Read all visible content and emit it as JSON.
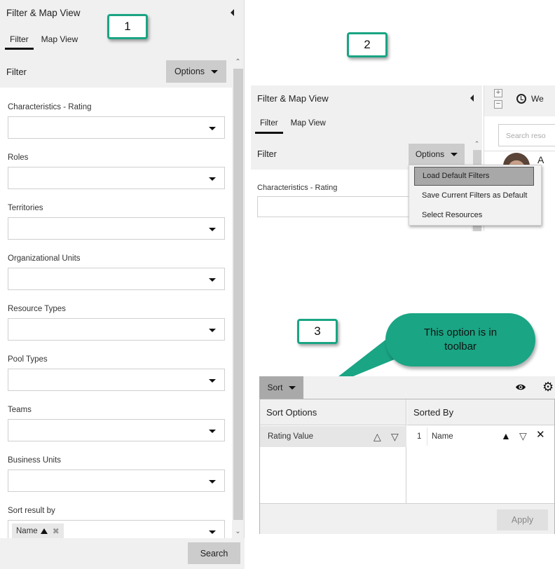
{
  "colors": {
    "accent_teal": "#1aa584",
    "panel_bg": "#f0f0f0",
    "button_bg": "#cccccc",
    "menu_highlight": "#a8a8a8"
  },
  "steps": [
    "1",
    "2",
    "3"
  ],
  "panel1": {
    "title": "Filter & Map View",
    "tabs": [
      {
        "label": "Filter",
        "active": true
      },
      {
        "label": "Map View",
        "active": false
      }
    ],
    "filter_label": "Filter",
    "options_label": "Options",
    "fields": [
      {
        "label": "Characteristics - Rating",
        "value": ""
      },
      {
        "label": "Roles",
        "value": ""
      },
      {
        "label": "Territories",
        "value": ""
      },
      {
        "label": "Organizational Units",
        "value": ""
      },
      {
        "label": "Resource Types",
        "value": ""
      },
      {
        "label": "Pool Types",
        "value": ""
      },
      {
        "label": "Teams",
        "value": ""
      },
      {
        "label": "Business Units",
        "value": ""
      }
    ],
    "sort": {
      "label": "Sort result by",
      "chip": "Name",
      "chip_direction": "ascending"
    },
    "search_label": "Search"
  },
  "panel2": {
    "title": "Filter & Map View",
    "tabs": [
      {
        "label": "Filter",
        "active": true
      },
      {
        "label": "Map View",
        "active": false
      }
    ],
    "filter_label": "Filter",
    "options_label": "Options",
    "field_label": "Characteristics - Rating",
    "menu": [
      {
        "label": "Load Default Filters",
        "highlighted": true
      },
      {
        "label": "Save Current Filters as Default",
        "highlighted": false
      },
      {
        "label": "Select Resources",
        "highlighted": false
      }
    ],
    "right": {
      "time_label": "We",
      "search_placeholder": "Search reso",
      "resource_initial": "A"
    }
  },
  "panel3": {
    "callout": "This option is in toolbar",
    "sort_label": "Sort",
    "sort_options_header": "Sort Options",
    "sorted_by_header": "Sorted By",
    "sort_options": [
      {
        "label": "Rating Value"
      }
    ],
    "sorted_by": [
      {
        "index": "1",
        "label": "Name",
        "direction": "ascending"
      }
    ],
    "apply_label": "Apply"
  }
}
